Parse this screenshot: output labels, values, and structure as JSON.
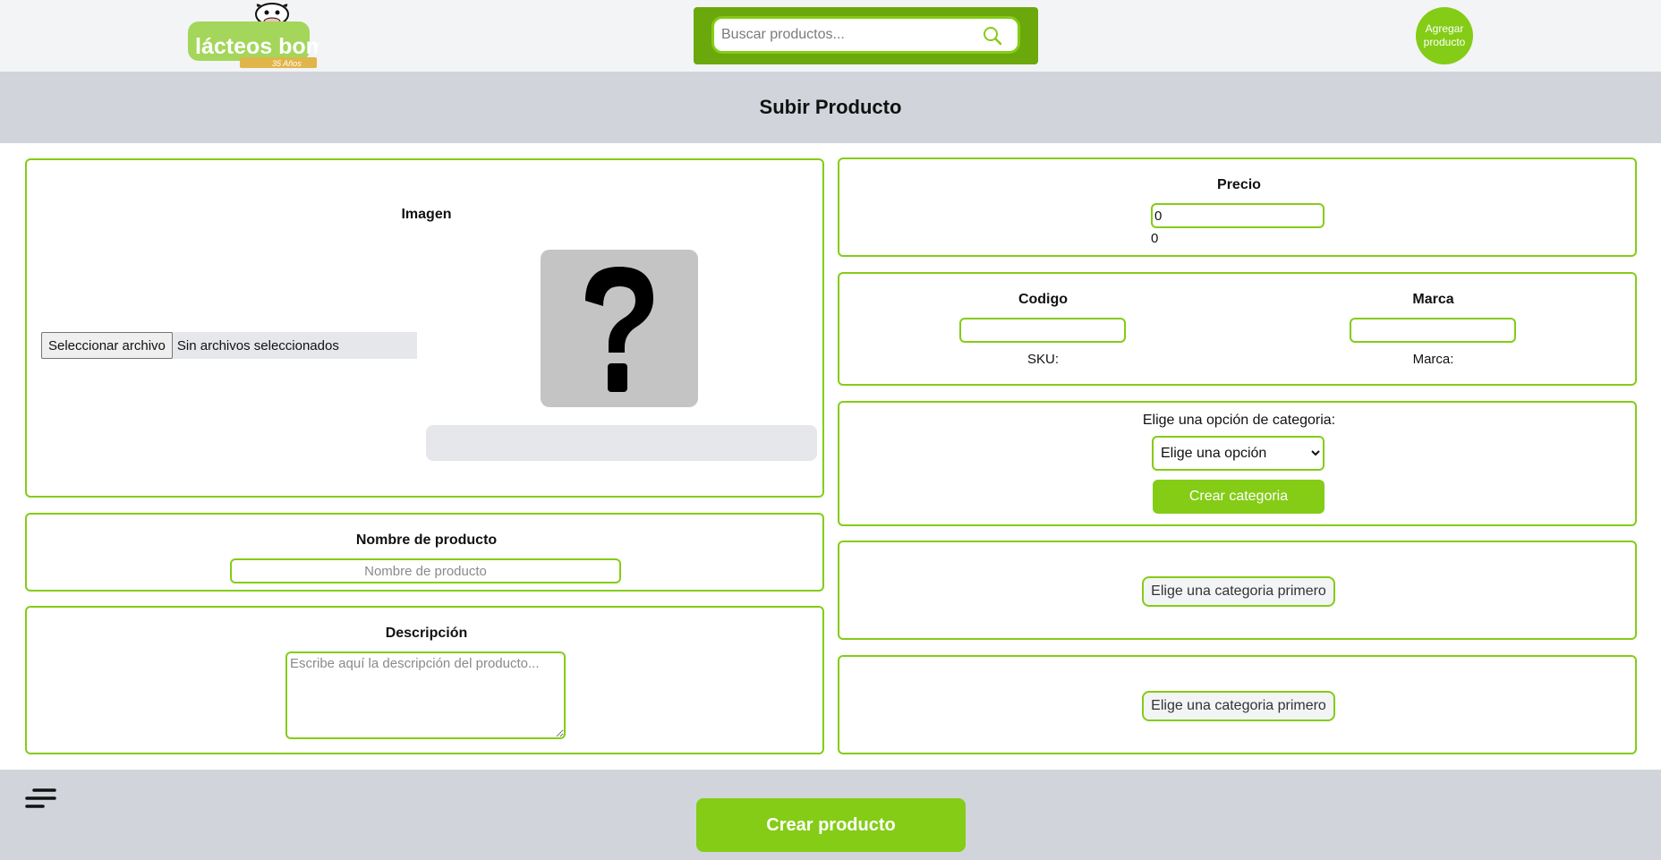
{
  "header": {
    "logo_text": "lácteos bomboná",
    "logo_tagline": "35 Años",
    "search_placeholder": "Buscar productos...",
    "add_product_label": "Agregar producto"
  },
  "page_title": "Subir Producto",
  "image_card": {
    "label": "Imagen",
    "file_button": "Seleccionar archivo",
    "file_status": "Sin archivos seleccionados"
  },
  "name_card": {
    "label": "Nombre de producto",
    "placeholder": "Nombre de producto"
  },
  "description_card": {
    "label": "Descripción",
    "placeholder": "Escribe aquí la descripción del producto..."
  },
  "price_card": {
    "label": "Precio",
    "value": "0",
    "display": "0"
  },
  "code_brand_card": {
    "code_label": "Codigo",
    "brand_label": "Marca",
    "sku_text": "SKU:",
    "brand_text": "Marca:"
  },
  "category_card": {
    "prompt": "Elige una opción de categoria:",
    "selected_option": "Elige una opción",
    "create_button": "Crear categoria"
  },
  "subcategory_cards": [
    {
      "button": "Elige una categoria primero"
    },
    {
      "button": "Elige una categoria primero"
    }
  ],
  "footer": {
    "create_product_button": "Crear producto"
  },
  "colors": {
    "accent": "#84cc16",
    "search_bg": "#6aa80c",
    "bar_gray": "#d1d5db"
  }
}
